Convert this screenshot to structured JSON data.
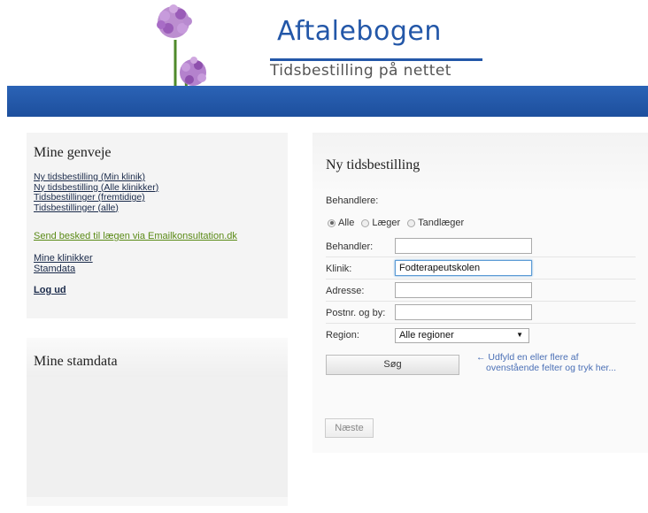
{
  "header": {
    "logo_title": "Aftalebogen",
    "logo_subtitle": "Tidsbestilling på nettet",
    "brand_color": "#2357a8"
  },
  "shortcuts": {
    "title": "Mine genveje",
    "links": [
      "Ny tidsbestilling (Min klinik)",
      "Ny tidsbestilling (Alle klinikker)",
      "Tidsbestillinger (fremtidige)",
      "Tidsbestillinger (alle)"
    ],
    "email_link": "Send besked til lægen via Emailkonsultation.dk",
    "links2": [
      "Mine klinikker",
      "Stamdata"
    ],
    "logout": "Log ud"
  },
  "stamdata": {
    "title": "Mine stamdata"
  },
  "booking": {
    "title": "Ny tidsbestilling",
    "behandlere_label": "Behandlere:",
    "radio_options": [
      "Alle",
      "Læger",
      "Tandlæger"
    ],
    "radio_selected": "Alle",
    "fields": {
      "behandler_label": "Behandler:",
      "behandler_value": "",
      "klinik_label": "Klinik:",
      "klinik_value": "Fodterapeutskolen",
      "adresse_label": "Adresse:",
      "adresse_value": "",
      "postnr_label": "Postnr. og by:",
      "postnr_value": "",
      "region_label": "Region:",
      "region_value": "Alle regioner"
    },
    "search_button": "Søg",
    "hint_line1": "← Udfyld en eller flere af",
    "hint_line2": "ovenstående felter og tryk her...",
    "next_button": "Næste"
  }
}
